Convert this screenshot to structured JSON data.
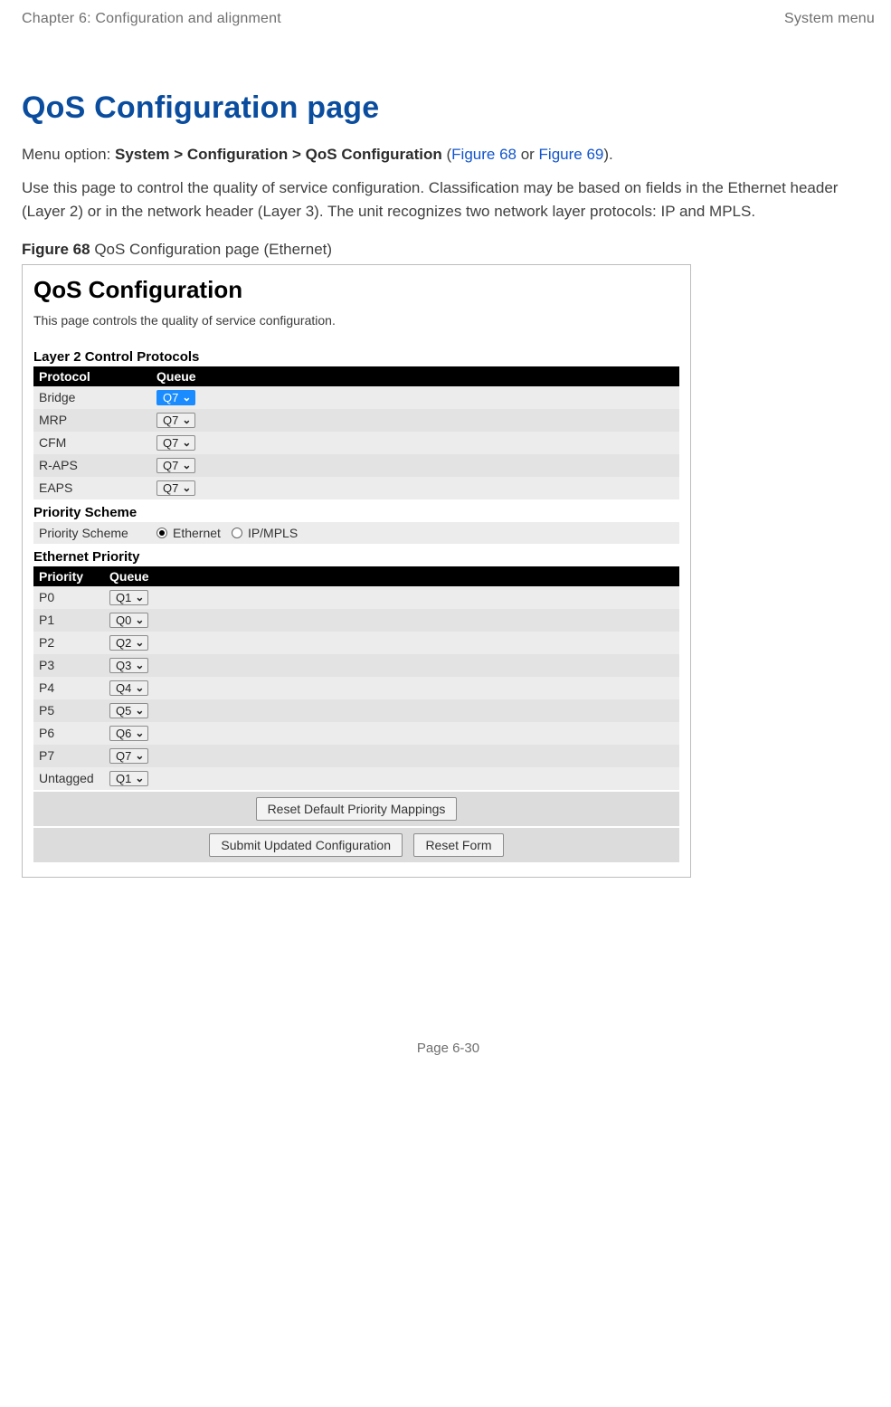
{
  "header": {
    "left": "Chapter 6:  Configuration and alignment",
    "right": "System menu"
  },
  "main": {
    "heading": "QoS Configuration page",
    "menu_prefix": "Menu option: ",
    "menu_path": "System > Configuration > QoS Configuration",
    "menu_suffix_open": " (",
    "figref1": "Figure 68",
    "menu_or": " or ",
    "figref2": "Figure 69",
    "menu_close": ").",
    "body": "Use this page to control the quality of service configuration. Classification may be based on fields in the Ethernet header (Layer 2) or in the network header (Layer 3). The unit recognizes two network layer protocols: IP and MPLS.",
    "fig_label": "Figure 68",
    "fig_caption": "  QoS Configuration page (Ethernet)"
  },
  "figure": {
    "title": "QoS Configuration",
    "subtitle": "This page controls the quality of service configuration.",
    "section_l2": "Layer 2 Control Protocols",
    "th_protocol": "Protocol",
    "th_queue": "Queue",
    "l2_rows": [
      {
        "proto": "Bridge",
        "q": "Q7",
        "hl": true
      },
      {
        "proto": "MRP",
        "q": "Q7",
        "hl": false
      },
      {
        "proto": "CFM",
        "q": "Q7",
        "hl": false
      },
      {
        "proto": "R-APS",
        "q": "Q7",
        "hl": false
      },
      {
        "proto": "EAPS",
        "q": "Q7",
        "hl": false
      }
    ],
    "section_scheme": "Priority Scheme",
    "scheme_label": "Priority Scheme",
    "scheme_opt1": "Ethernet",
    "scheme_opt2": "IP/MPLS",
    "section_eth": "Ethernet Priority",
    "th_priority": "Priority",
    "eth_rows": [
      {
        "p": "P0",
        "q": "Q1"
      },
      {
        "p": "P1",
        "q": "Q0"
      },
      {
        "p": "P2",
        "q": "Q2"
      },
      {
        "p": "P3",
        "q": "Q3"
      },
      {
        "p": "P4",
        "q": "Q4"
      },
      {
        "p": "P5",
        "q": "Q5"
      },
      {
        "p": "P6",
        "q": "Q6"
      },
      {
        "p": "P7",
        "q": "Q7"
      },
      {
        "p": "Untagged",
        "q": "Q1"
      }
    ],
    "btn_reset_map": "Reset Default Priority Mappings",
    "btn_submit": "Submit Updated Configuration",
    "btn_reset_form": "Reset Form"
  },
  "footer": {
    "page_label": "Page ",
    "page_num": "6-30"
  }
}
